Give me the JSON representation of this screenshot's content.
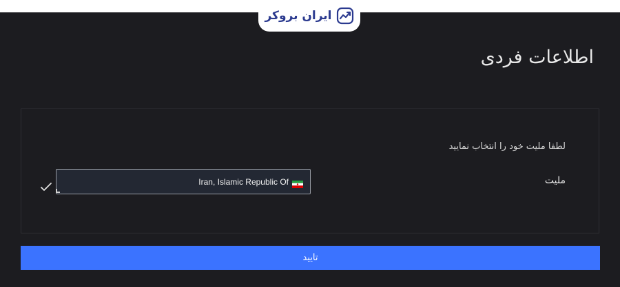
{
  "brand": {
    "name": "ایران بروکر",
    "accent": "#2b3a8f",
    "icon": "chart-trend-icon"
  },
  "page": {
    "title": "اطلاعات فردی"
  },
  "form": {
    "instruction": "لطفا ملیت خود را انتخاب نمایید",
    "nationality_label": "ملیت",
    "nationality_value": "Iran, Islamic Republic Of",
    "flag_icon": "iran-flag-icon",
    "status_icon": "checkmark-icon"
  },
  "actions": {
    "confirm_label": "تایید",
    "confirm_color": "#3b73ff"
  }
}
